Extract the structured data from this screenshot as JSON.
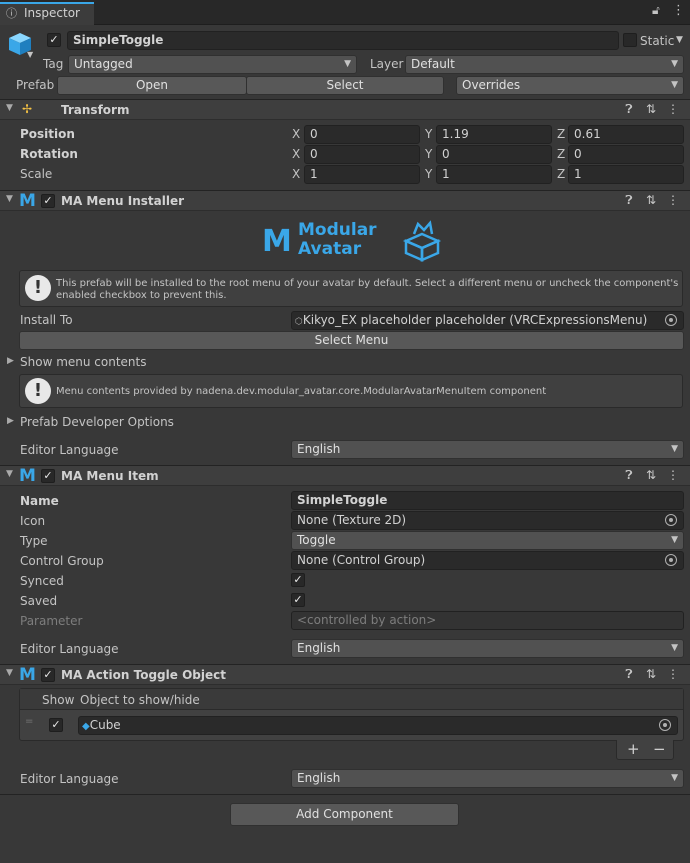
{
  "tab": {
    "label": "Inspector"
  },
  "object": {
    "name": "SimpleToggle",
    "static_label": "Static",
    "tag_label": "Tag",
    "tag_value": "Untagged",
    "layer_label": "Layer",
    "layer_value": "Default"
  },
  "prefab": {
    "label": "Prefab",
    "open": "Open",
    "select": "Select",
    "overrides": "Overrides"
  },
  "transform": {
    "title": "Transform",
    "position_label": "Position",
    "rotation_label": "Rotation",
    "scale_label": "Scale",
    "x": "X",
    "y": "Y",
    "z": "Z",
    "position": [
      "0",
      "1.19",
      "0.61"
    ],
    "rotation": [
      "0",
      "0",
      "0"
    ],
    "scale": [
      "1",
      "1",
      "1"
    ]
  },
  "menu_installer": {
    "title": "MA Menu Installer",
    "logo_line1": "Modular",
    "logo_line2": "Avatar",
    "help_line1": "This prefab will be installed to the root menu of your avatar by default. Select a different menu or uncheck the component's",
    "help_line2": "enabled checkbox to prevent this.",
    "install_to_label": "Install To",
    "install_to_value": "Kikyo_EX placeholder placeholder (VRCExpressionsMenu)",
    "select_menu": "Select Menu",
    "show_contents": "Show menu contents",
    "contents_help": "Menu contents provided by nadena.dev.modular_avatar.core.ModularAvatarMenuItem component",
    "prefab_dev": "Prefab Developer Options",
    "editor_language_label": "Editor Language",
    "editor_language": "English"
  },
  "menu_item": {
    "title": "MA Menu Item",
    "name_label": "Name",
    "name_value": "SimpleToggle",
    "icon_label": "Icon",
    "icon_value": "None (Texture 2D)",
    "type_label": "Type",
    "type_value": "Toggle",
    "control_group_label": "Control Group",
    "control_group_value": "None (Control Group)",
    "synced_label": "Synced",
    "saved_label": "Saved",
    "parameter_label": "Parameter",
    "parameter_placeholder": "<controlled by action>",
    "editor_language_label": "Editor Language",
    "editor_language": "English"
  },
  "action_toggle": {
    "title": "MA Action Toggle Object",
    "col_show": "Show",
    "col_object": "Object to show/hide",
    "row_object": "Cube",
    "add": "+",
    "remove": "−",
    "editor_language_label": "Editor Language",
    "editor_language": "English"
  },
  "add_component": "Add Component",
  "icons": {
    "lock": "lock-icon",
    "menu": "kebab-menu-icon",
    "help": "help-icon",
    "presets": "presets-icon",
    "cube": "cube-icon"
  },
  "colors": {
    "accent": "#3aa7e8",
    "background": "#383838"
  }
}
